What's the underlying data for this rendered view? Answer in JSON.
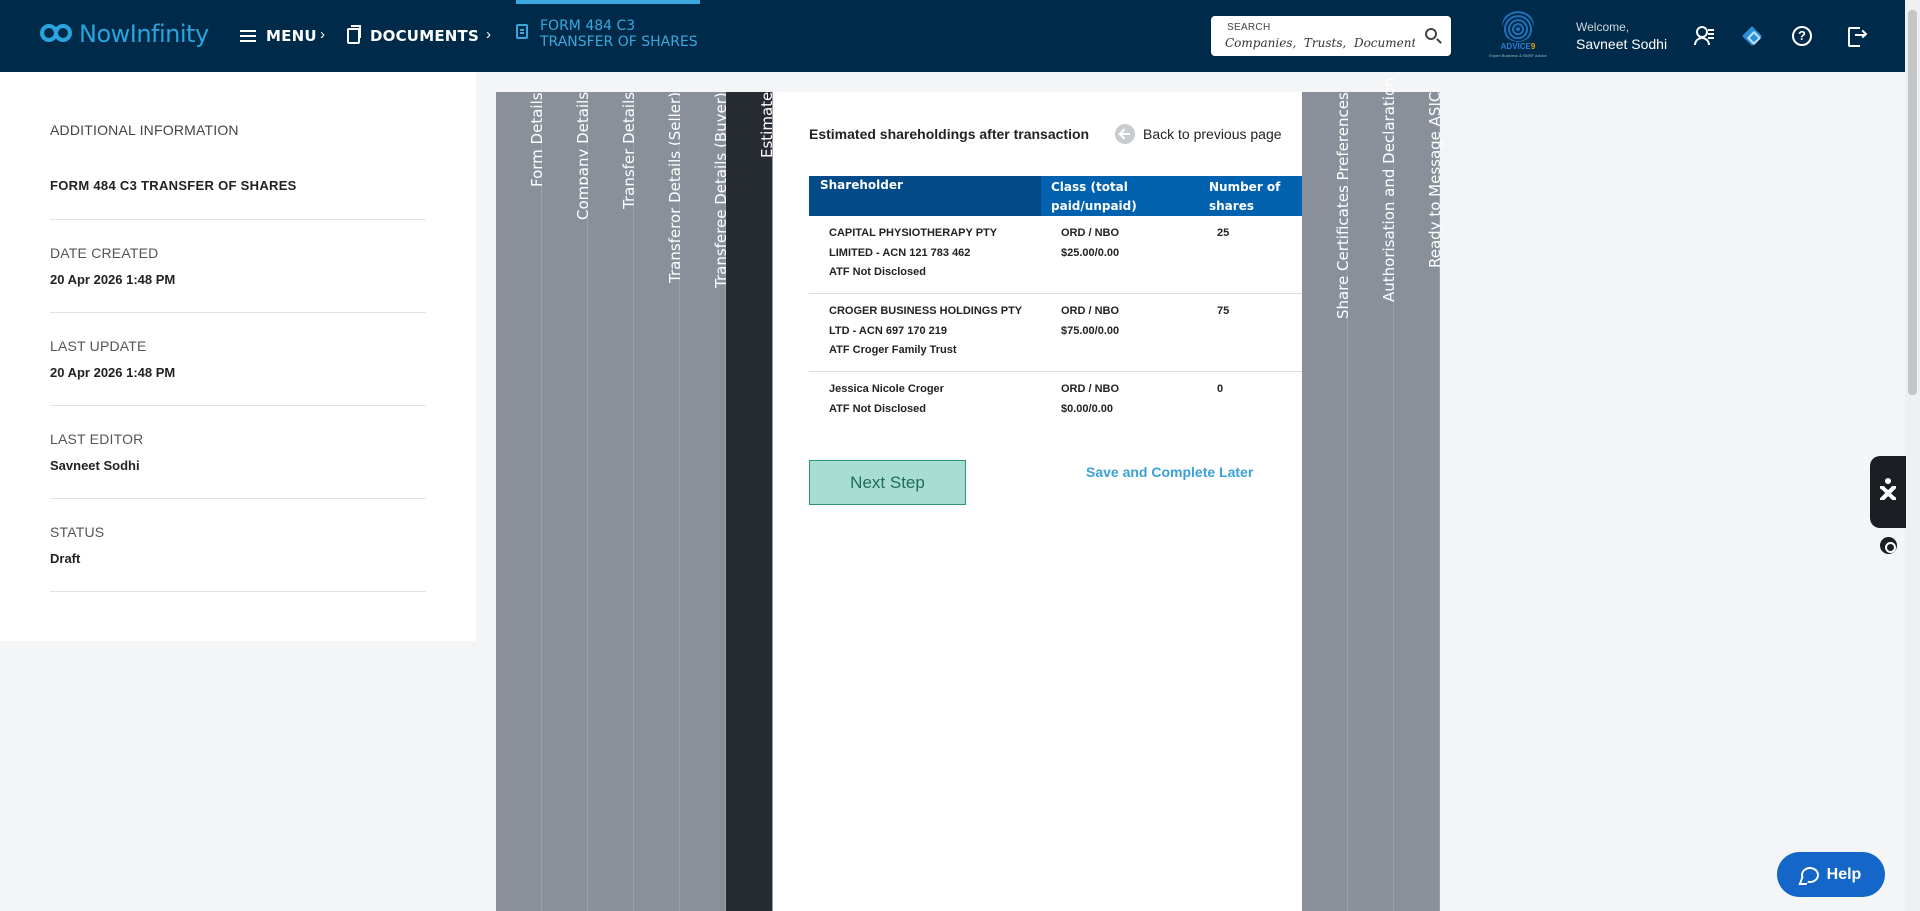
{
  "header": {
    "logo_text": "NowInfinity",
    "nav": {
      "menu_label": "MENU",
      "documents_label": "DOCUMENTS",
      "active_doc_label": "FORM 484 C3 TRANSFER OF SHARES"
    },
    "search": {
      "label": "SEARCH",
      "placeholder": "Companies,  Trusts,  Documents"
    },
    "brand": {
      "name_a": "ADVICE",
      "name_b": "9",
      "tagline": "Expert Business & SMSF Advice"
    },
    "welcome_label": "Welcome,",
    "user_name": "Savneet Sodhi",
    "icons": [
      "menu-icon",
      "documents-icon",
      "form-icon",
      "search-icon",
      "user-list-icon",
      "diamond-icon",
      "help-icon",
      "logout-icon"
    ]
  },
  "info_panel": {
    "heading": "ADDITIONAL INFORMATION",
    "form_name": "FORM 484 C3 TRANSFER OF SHARES",
    "date_created_label": "DATE CREATED",
    "date_created": "20 Apr 2026 1:48 PM",
    "last_update_label": "LAST UPDATE",
    "last_update": "20 Apr 2026 1:48 PM",
    "last_editor_label": "LAST EDITOR",
    "last_editor": "Savneet Sodhi",
    "status_label": "STATUS",
    "status": "Draft"
  },
  "wizard": {
    "steps_before": [
      "Form Details",
      "Company Details",
      "Transfer Details",
      "Transferor Details (Seller)",
      "Transferee Details (Buyer)"
    ],
    "active_step": "Estimate",
    "steps_after": [
      "Share Certificates Preferences",
      "Authorisation and Declaration",
      "Ready to Message ASIC"
    ]
  },
  "estimate": {
    "title": "Estimated shareholdings after transaction",
    "back_label": "Back to previous page",
    "columns": {
      "shareholder": "Shareholder",
      "class_line1": "Class (total",
      "class_line2": "paid/unpaid)",
      "number_line1": "Number of",
      "number_line2": "shares"
    },
    "rows": [
      {
        "name_line1": "CAPITAL PHYSIOTHERAPY PTY",
        "name_line2": "LIMITED - ACN 121 783 462",
        "name_line3": "ATF Not Disclosed",
        "class": "ORD / NBO",
        "paid": "$25.00/0.00",
        "shares": "25"
      },
      {
        "name_line1": "CROGER BUSINESS HOLDINGS PTY",
        "name_line2": "LTD - ACN 697 170 219",
        "name_line3": "ATF Croger Family Trust",
        "class": "ORD / NBO",
        "paid": "$75.00/0.00",
        "shares": "75"
      },
      {
        "name_line1": "Jessica Nicole Croger",
        "name_line2": "ATF Not Disclosed",
        "name_line3": "",
        "class": "ORD / NBO",
        "paid": "$0.00/0.00",
        "shares": "0"
      }
    ],
    "next_label": "Next Step",
    "later_label": "Save and Complete Later"
  },
  "help_label": "Help",
  "colors": {
    "topbar": "#002a4a",
    "accent": "#3aa8dc",
    "table_header": "#0262b0",
    "next_button": "#a7ded1"
  }
}
